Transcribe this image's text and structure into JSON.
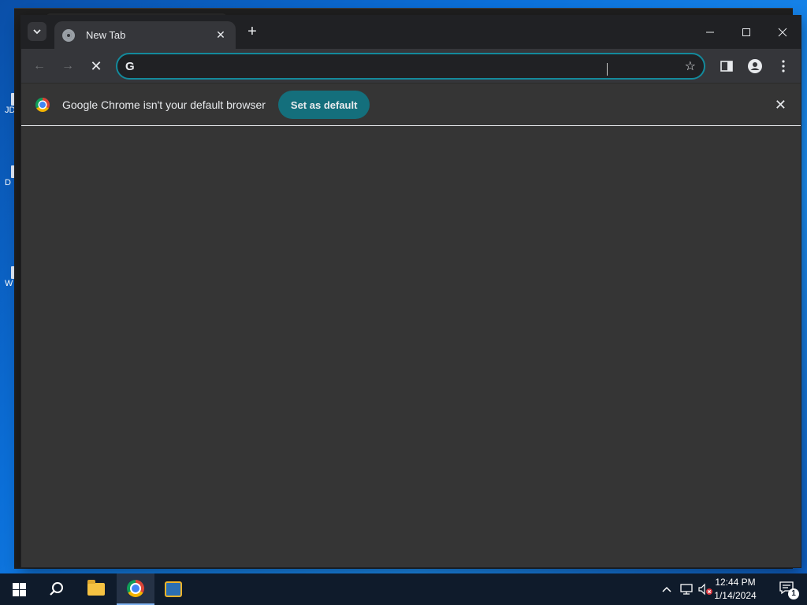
{
  "desktop": {
    "icon_labels": [
      "JD",
      "D",
      "W"
    ]
  },
  "browser": {
    "tab": {
      "title": "New Tab",
      "close_glyph": "✕"
    },
    "new_tab_glyph": "+",
    "window_controls": {
      "minimize": "—",
      "maximize": "☐",
      "close": "✕"
    },
    "toolbar": {
      "back": "←",
      "forward": "→",
      "stop": "✕",
      "omnibox_value": "",
      "search_engine_icon": "G",
      "bookmark_icon": "☆"
    },
    "infobar": {
      "message": "Google Chrome isn't your default browser",
      "button": "Set as default",
      "close_glyph": "✕"
    }
  },
  "taskbar": {
    "clock_time": "12:44 PM",
    "clock_date": "1/14/2024",
    "notification_count": "1",
    "tray_chevron": "^"
  },
  "colors": {
    "accent_teal": "#138a9c",
    "button_teal": "#146f7c",
    "chrome_dark": "#202124",
    "content_bg": "#353535"
  }
}
